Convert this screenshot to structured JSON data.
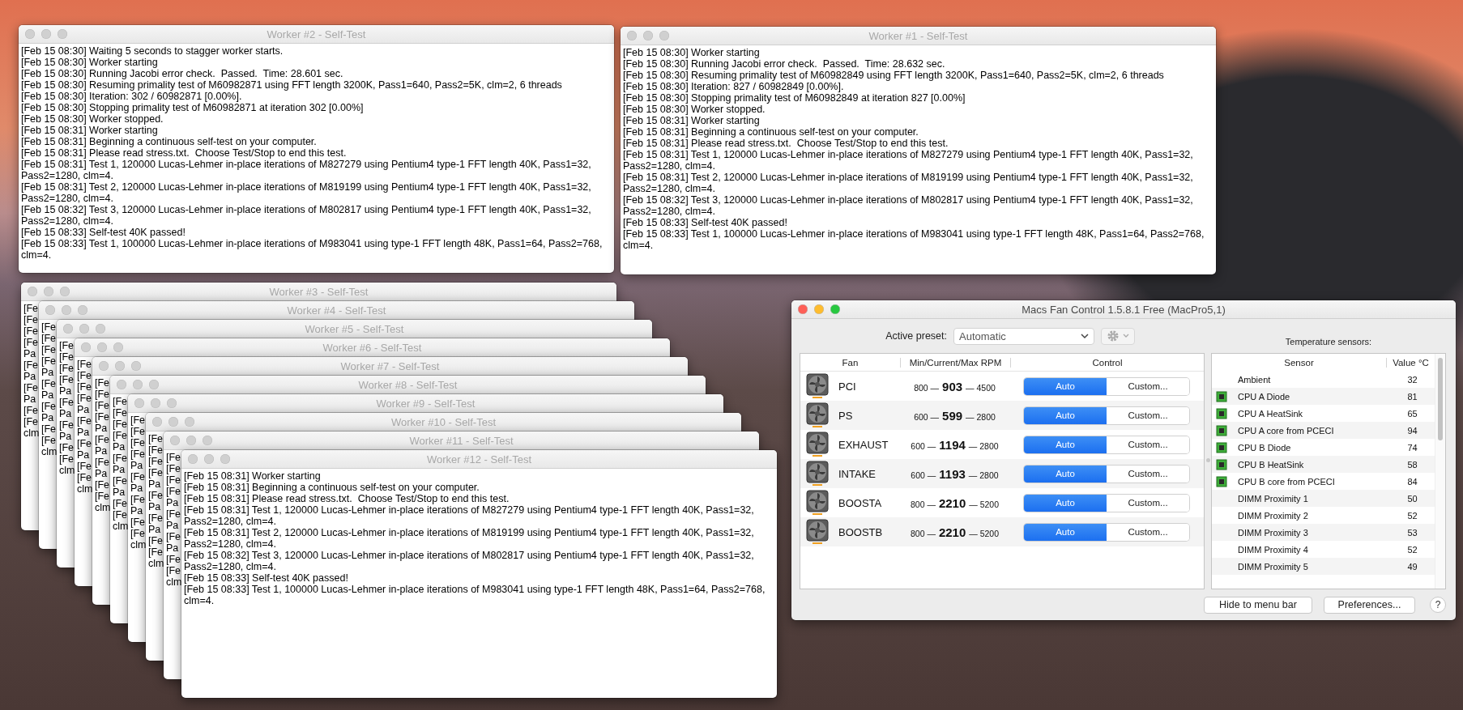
{
  "windows": [
    {
      "kind": "log",
      "title": "Worker #2 - Self-Test",
      "active": false,
      "lines": [
        "[Feb 15 08:30] Waiting 5 seconds to stagger worker starts.",
        "[Feb 15 08:30] Worker starting",
        "[Feb 15 08:30] Running Jacobi error check.  Passed.  Time: 28.601 sec.",
        "[Feb 15 08:30] Resuming primality test of M60982871 using FFT length 3200K, Pass1=640, Pass2=5K, clm=2, 6 threads",
        "[Feb 15 08:30] Iteration: 302 / 60982871 [0.00%].",
        "[Feb 15 08:30] Stopping primality test of M60982871 at iteration 302 [0.00%]",
        "[Feb 15 08:30] Worker stopped.",
        "[Feb 15 08:31] Worker starting",
        "[Feb 15 08:31] Beginning a continuous self-test on your computer.",
        "[Feb 15 08:31] Please read stress.txt.  Choose Test/Stop to end this test.",
        "[Feb 15 08:31] Test 1, 120000 Lucas-Lehmer in-place iterations of M827279 using Pentium4 type-1 FFT length 40K, Pass1=32, Pass2=1280, clm=4.",
        "[Feb 15 08:31] Test 2, 120000 Lucas-Lehmer in-place iterations of M819199 using Pentium4 type-1 FFT length 40K, Pass1=32, Pass2=1280, clm=4.",
        "[Feb 15 08:32] Test 3, 120000 Lucas-Lehmer in-place iterations of M802817 using Pentium4 type-1 FFT length 40K, Pass1=32, Pass2=1280, clm=4.",
        "[Feb 15 08:33] Self-test 40K passed!",
        "[Feb 15 08:33] Test 1, 100000 Lucas-Lehmer in-place iterations of M983041 using type-1 FFT length 48K, Pass1=64, Pass2=768, clm=4."
      ]
    },
    {
      "kind": "log",
      "title": "Worker #1 - Self-Test",
      "active": false,
      "lines": [
        "[Feb 15 08:30] Worker starting",
        "[Feb 15 08:30] Running Jacobi error check.  Passed.  Time: 28.632 sec.",
        "[Feb 15 08:30] Resuming primality test of M60982849 using FFT length 3200K, Pass1=640, Pass2=5K, clm=2, 6 threads",
        "[Feb 15 08:30] Iteration: 827 / 60982849 [0.00%].",
        "[Feb 15 08:30] Stopping primality test of M60982849 at iteration 827 [0.00%]",
        "[Feb 15 08:30] Worker stopped.",
        "[Feb 15 08:31] Worker starting",
        "[Feb 15 08:31] Beginning a continuous self-test on your computer.",
        "[Feb 15 08:31] Please read stress.txt.  Choose Test/Stop to end this test.",
        "[Feb 15 08:31] Test 1, 120000 Lucas-Lehmer in-place iterations of M827279 using Pentium4 type-1 FFT length 40K, Pass1=32, Pass2=1280, clm=4.",
        "[Feb 15 08:31] Test 2, 120000 Lucas-Lehmer in-place iterations of M819199 using Pentium4 type-1 FFT length 40K, Pass1=32, Pass2=1280, clm=4.",
        "[Feb 15 08:32] Test 3, 120000 Lucas-Lehmer in-place iterations of M802817 using Pentium4 type-1 FFT length 40K, Pass1=32, Pass2=1280, clm=4.",
        "[Feb 15 08:33] Self-test 40K passed!",
        "[Feb 15 08:33] Test 1, 100000 Lucas-Lehmer in-place iterations of M983041 using type-1 FFT length 48K, Pass1=64, Pass2=768, clm=4."
      ]
    },
    {
      "kind": "log",
      "title": "Worker #3 - Self-Test",
      "active": false,
      "lines": [
        "[Fe",
        "[Fe",
        "[Fe",
        "[Fe",
        "Pa",
        "[Fe",
        "Pa",
        "[Fe",
        "Pa",
        "[Fe",
        "[Fe",
        "clm"
      ]
    },
    {
      "kind": "log",
      "title": "Worker #4 - Self-Test",
      "active": false,
      "lines": [
        "[Fe",
        "[Fe",
        "[Fe",
        "[Fe",
        "Pa",
        "[Fe",
        "Pa",
        "[Fe",
        "Pa",
        "[Fe",
        "[Fe",
        "clm"
      ]
    },
    {
      "kind": "log",
      "title": "Worker #5 - Self-Test",
      "active": false,
      "lines": [
        "[Fe",
        "[Fe",
        "[Fe",
        "[Fe",
        "Pa",
        "[Fe",
        "Pa",
        "[Fe",
        "Pa",
        "[Fe",
        "[Fe",
        "clm"
      ]
    },
    {
      "kind": "log",
      "title": "Worker #6 - Self-Test",
      "active": false,
      "lines": [
        "[Fe",
        "[Fe",
        "[Fe",
        "[Fe",
        "Pa",
        "[Fe",
        "Pa",
        "[Fe",
        "Pa",
        "[Fe",
        "[Fe",
        "clm"
      ]
    },
    {
      "kind": "log",
      "title": "Worker #7 - Self-Test",
      "active": false,
      "lines": [
        "[Fe",
        "[Fe",
        "[Fe",
        "[Fe",
        "Pa",
        "[Fe",
        "Pa",
        "[Fe",
        "Pa",
        "[Fe",
        "[Fe",
        "clm"
      ]
    },
    {
      "kind": "log",
      "title": "Worker #8 - Self-Test",
      "active": false,
      "lines": [
        "[Fe",
        "[Fe",
        "[Fe",
        "[Fe",
        "Pa",
        "[Fe",
        "Pa",
        "[Fe",
        "Pa",
        "[Fe",
        "[Fe",
        "clm"
      ]
    },
    {
      "kind": "log",
      "title": "Worker #9 - Self-Test",
      "active": false,
      "lines": [
        "[Fe",
        "[Fe",
        "[Fe",
        "[Fe",
        "Pa",
        "[Fe",
        "Pa",
        "[Fe",
        "Pa",
        "[Fe",
        "[Fe",
        "clm"
      ]
    },
    {
      "kind": "log",
      "title": "Worker #10 - Self-Test",
      "active": false,
      "lines": [
        "[Fe",
        "[Fe",
        "[Fe",
        "[Fe",
        "Pa",
        "[Fe",
        "Pa",
        "[Fe",
        "Pa",
        "[Fe",
        "[Fe",
        "clm"
      ]
    },
    {
      "kind": "log",
      "title": "Worker #11 - Self-Test",
      "active": false,
      "lines": [
        "[Fe",
        "[Fe",
        "[Fe",
        "[Fe",
        "Pa",
        "[Fe",
        "Pa",
        "[Fe",
        "Pa",
        "[Fe",
        "[Fe",
        "clm"
      ]
    },
    {
      "kind": "log",
      "title": "Worker #12 - Self-Test",
      "active": false,
      "lines": [
        "[Feb 15 08:31] Worker starting",
        "[Feb 15 08:31] Beginning a continuous self-test on your computer.",
        "[Feb 15 08:31] Please read stress.txt.  Choose Test/Stop to end this test.",
        "[Feb 15 08:31] Test 1, 120000 Lucas-Lehmer in-place iterations of M827279 using Pentium4 type-1 FFT length 40K, Pass1=32, Pass2=1280, clm=4.",
        "[Feb 15 08:31] Test 2, 120000 Lucas-Lehmer in-place iterations of M819199 using Pentium4 type-1 FFT length 40K, Pass1=32, Pass2=1280, clm=4.",
        "[Feb 15 08:32] Test 3, 120000 Lucas-Lehmer in-place iterations of M802817 using Pentium4 type-1 FFT length 40K, Pass1=32, Pass2=1280, clm=4.",
        "[Feb 15 08:33] Self-test 40K passed!",
        "[Feb 15 08:33] Test 1, 100000 Lucas-Lehmer in-place iterations of M983041 using type-1 FFT length 48K, Pass1=64, Pass2=768, clm=4."
      ]
    },
    {
      "kind": "fan_control",
      "title": "Macs Fan Control 1.5.8.1 Free (MacPro5,1)",
      "active": true,
      "preset_label": "Active preset:",
      "preset": "Automatic",
      "sensors_label": "Temperature sensors:",
      "fan_columns": [
        "Fan",
        "Min/Current/Max RPM",
        "Control"
      ],
      "fans": [
        {
          "name": "PCI",
          "min": "800 —",
          "current": "903",
          "max": "— 4500",
          "modes": [
            {
              "label": "Auto",
              "selected": true
            },
            {
              "label": "Custom...",
              "selected": false
            }
          ]
        },
        {
          "name": "PS",
          "min": "600 —",
          "current": "599",
          "max": "— 2800",
          "modes": [
            {
              "label": "Auto",
              "selected": true
            },
            {
              "label": "Custom...",
              "selected": false
            }
          ]
        },
        {
          "name": "EXHAUST",
          "min": "600 —",
          "current": "1194",
          "max": "— 2800",
          "modes": [
            {
              "label": "Auto",
              "selected": true
            },
            {
              "label": "Custom...",
              "selected": false
            }
          ]
        },
        {
          "name": "INTAKE",
          "min": "600 —",
          "current": "1193",
          "max": "— 2800",
          "modes": [
            {
              "label": "Auto",
              "selected": true
            },
            {
              "label": "Custom...",
              "selected": false
            }
          ]
        },
        {
          "name": "BOOSTA",
          "min": "800 —",
          "current": "2210",
          "max": "— 5200",
          "modes": [
            {
              "label": "Auto",
              "selected": true
            },
            {
              "label": "Custom...",
              "selected": false
            }
          ]
        },
        {
          "name": "BOOSTB",
          "min": "800 —",
          "current": "2210",
          "max": "— 5200",
          "modes": [
            {
              "label": "Auto",
              "selected": true
            },
            {
              "label": "Custom...",
              "selected": false
            }
          ]
        }
      ],
      "sensor_columns": [
        "Sensor",
        "Value °C"
      ],
      "sensors": [
        {
          "kind": "plain",
          "name": "Ambient",
          "value": "32"
        },
        {
          "kind": "chip",
          "name": "CPU A Diode",
          "value": "81"
        },
        {
          "kind": "chip",
          "name": "CPU A HeatSink",
          "value": "65"
        },
        {
          "kind": "chip",
          "name": "CPU A core from PCECI",
          "value": "94"
        },
        {
          "kind": "chip",
          "name": "CPU B Diode",
          "value": "74"
        },
        {
          "kind": "chip",
          "name": "CPU B HeatSink",
          "value": "58"
        },
        {
          "kind": "chip",
          "name": "CPU B core from PCECI",
          "value": "84"
        },
        {
          "kind": "plain",
          "name": "DIMM Proximity 1",
          "value": "50"
        },
        {
          "kind": "plain",
          "name": "DIMM Proximity 2",
          "value": "52"
        },
        {
          "kind": "plain",
          "name": "DIMM Proximity 3",
          "value": "53"
        },
        {
          "kind": "plain",
          "name": "DIMM Proximity 4",
          "value": "52"
        },
        {
          "kind": "plain",
          "name": "DIMM Proximity 5",
          "value": "49"
        }
      ],
      "buttons": [
        "Hide to menu bar",
        "Preferences...",
        "?"
      ]
    }
  ]
}
